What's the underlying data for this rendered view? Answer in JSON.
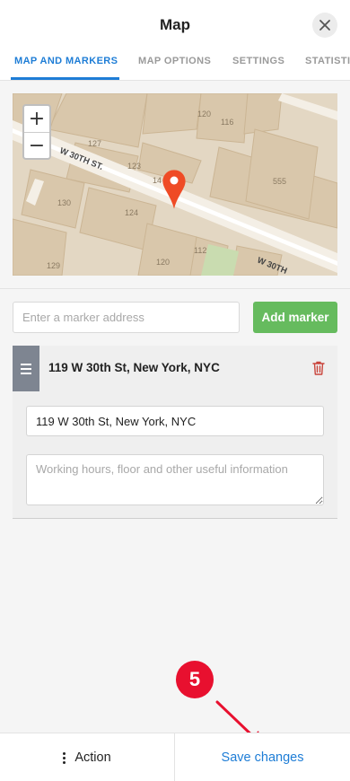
{
  "header": {
    "title": "Map",
    "tabs": [
      {
        "label": "MAP AND MARKERS",
        "active": true
      },
      {
        "label": "MAP OPTIONS",
        "active": false
      },
      {
        "label": "SETTINGS",
        "active": false
      },
      {
        "label": "STATISTI",
        "active": false
      }
    ],
    "close_icon": "close-icon"
  },
  "map": {
    "zoom_in": "+",
    "zoom_out": "−",
    "street_labels": [
      "W 30TH ST.",
      "W 30TH"
    ],
    "building_numbers": [
      "127",
      "123",
      "120",
      "116",
      "130",
      "124",
      "555",
      "129",
      "120",
      "112",
      "14"
    ],
    "marker_icon": "map-pin-icon"
  },
  "add_marker": {
    "placeholder": "Enter a marker address",
    "button_label": "Add marker"
  },
  "marker": {
    "title": "119 W 30th St, New York, NYC",
    "address_value": "119 W 30th St, New York, NYC",
    "notes_placeholder": "Working hours, floor and other useful information"
  },
  "annotation": {
    "step_number": "5"
  },
  "footer": {
    "action_label": "Action",
    "save_label": "Save changes"
  },
  "colors": {
    "accent": "#1e7dd6",
    "add_button": "#66bb5e",
    "marker_pin": "#ef4b25",
    "badge": "#e8102f",
    "delete_icon": "#c9443b"
  }
}
